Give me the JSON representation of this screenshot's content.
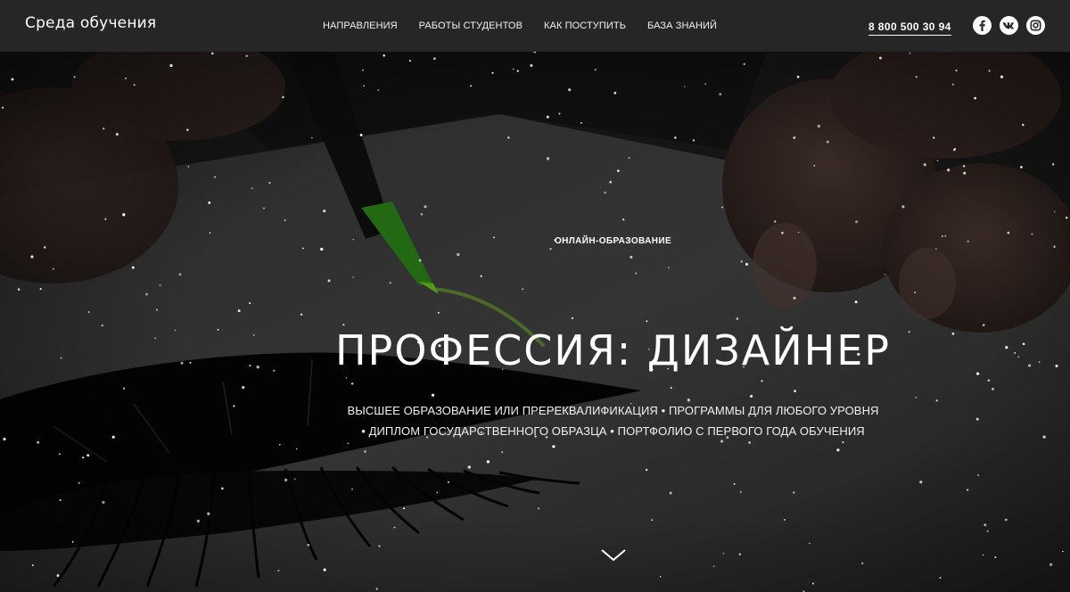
{
  "header": {
    "logo": "Среда обучения",
    "nav": [
      {
        "label": "НАПРАВЛЕНИЯ"
      },
      {
        "label": "РАБОТЫ СТУДЕНТОВ"
      },
      {
        "label": "КАК ПОСТУПИТЬ"
      },
      {
        "label": "БАЗА ЗНАНИЙ"
      }
    ],
    "phone": "8 800 500 30 94",
    "socials": [
      "facebook-icon",
      "vk-icon",
      "instagram-icon"
    ]
  },
  "hero": {
    "eyebrow": "ОНЛАЙН-ОБРАЗОВАНИЕ",
    "title": "ПРОФЕССИЯ: ДИЗАЙНЕР",
    "subtitle_line1": "ВЫСШЕЕ ОБРАЗОВАНИЕ ИЛИ ПРЕРЕКВАЛИФИКАЦИЯ • ПРОГРАММЫ ДЛЯ ЛЮБОГО УРОВНЯ",
    "subtitle_line2": "• ДИПЛОМ ГОСУДАРСТВЕННОГО ОБРАЗЦА • ПОРТФОЛИО С ПЕРВОГО ГОДА ОБУЧЕНИЯ",
    "scroll_icon": "chevron-down-icon"
  },
  "colors": {
    "header_bg": "#262626",
    "text": "#ffffff",
    "marker_tip": "#6fcf1f"
  }
}
